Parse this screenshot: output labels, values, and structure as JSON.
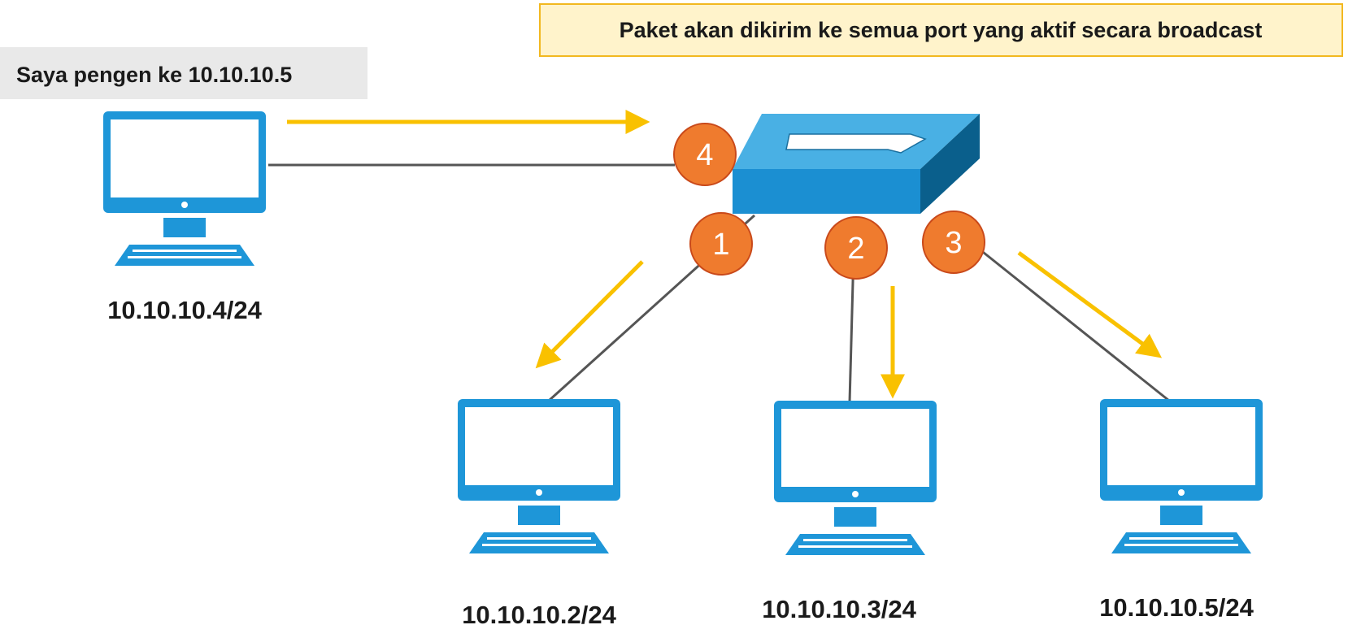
{
  "callouts": {
    "broadcast": "Paket akan dikirim ke semua port yang aktif secara broadcast",
    "request": "Saya pengen ke 10.10.10.5"
  },
  "hosts": {
    "source": {
      "ip": "10.10.10.4/24",
      "port": "4"
    },
    "host1": {
      "ip": "10.10.10.2/24",
      "port": "1"
    },
    "host2": {
      "ip": "10.10.10.3/24",
      "port": "2"
    },
    "host3": {
      "ip": "10.10.10.5/24",
      "port": "3"
    }
  },
  "colors": {
    "monitor": "#1e96d8",
    "switch_top": "#49b0e4",
    "switch_front": "#1b8fd2",
    "switch_side": "#0a5f8c",
    "port_badge": "#ef7b2e",
    "port_badge_border": "#c9491a",
    "arrow": "#f9c100",
    "cable": "#555555",
    "broadcast_box_fill": "#fff3cb",
    "broadcast_box_border": "#f2b820",
    "request_box_fill": "#e9e9e9"
  },
  "icons": {
    "computer": "desktop-computer-icon",
    "switch": "network-switch-icon"
  }
}
